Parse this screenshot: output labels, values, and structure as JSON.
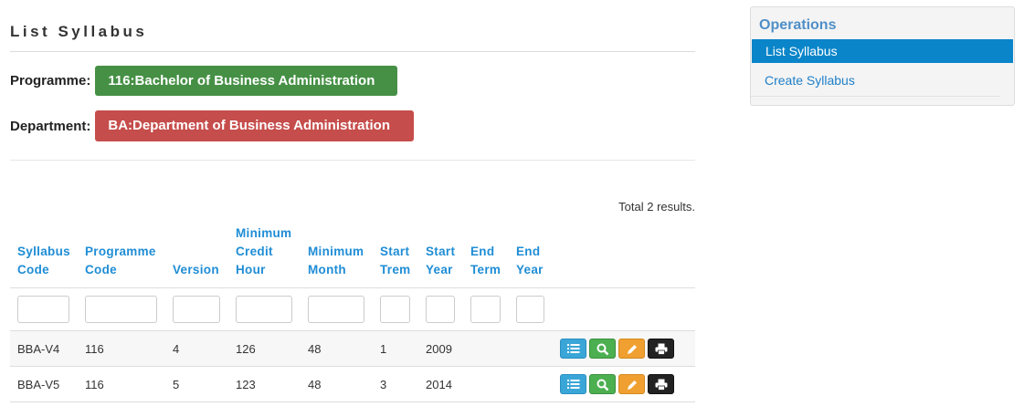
{
  "page": {
    "title": "List Syllabus",
    "programme_label": "Programme:",
    "programme_value": "116:Bachelor of Business Administration",
    "department_label": "Department:",
    "department_value": "BA:Department of Business Administration",
    "summary": "Total 2 results."
  },
  "table": {
    "columns": [
      {
        "line1": "Syllabus",
        "line2": "Code",
        "line0": ""
      },
      {
        "line1": "Programme",
        "line2": "Code",
        "line0": ""
      },
      {
        "line1": "",
        "line2": "Version",
        "line0": ""
      },
      {
        "line0": "Minimum",
        "line1": "Credit",
        "line2": "Hour"
      },
      {
        "line1": "Minimum",
        "line2": "Month",
        "line0": ""
      },
      {
        "line1": "Start",
        "line2": "Trem",
        "line0": ""
      },
      {
        "line1": "Start",
        "line2": "Year",
        "line0": ""
      },
      {
        "line1": "End",
        "line2": "Term",
        "line0": ""
      },
      {
        "line1": "End",
        "line2": "Year",
        "line0": ""
      }
    ],
    "rows": [
      {
        "syllabus_code": "BBA-V4",
        "programme_code": "116",
        "version": "4",
        "min_credit_hour": "126",
        "min_month": "48",
        "start_term": "1",
        "start_year": "2009",
        "end_term": "",
        "end_year": ""
      },
      {
        "syllabus_code": "BBA-V5",
        "programme_code": "116",
        "version": "5",
        "min_credit_hour": "123",
        "min_month": "48",
        "start_term": "3",
        "start_year": "2014",
        "end_term": "",
        "end_year": ""
      }
    ],
    "action_icons": [
      "list-icon",
      "search-icon",
      "pencil-icon",
      "print-icon"
    ]
  },
  "sidebar": {
    "title": "Operations",
    "items": [
      {
        "label": "List Syllabus",
        "active": true
      },
      {
        "label": "Create Syllabus",
        "active": false
      }
    ]
  },
  "colors": {
    "programme_badge": "#469045",
    "department_badge": "#c54d4b",
    "header_link": "#1f8dd6",
    "sidebar_active": "#0a85c9"
  }
}
